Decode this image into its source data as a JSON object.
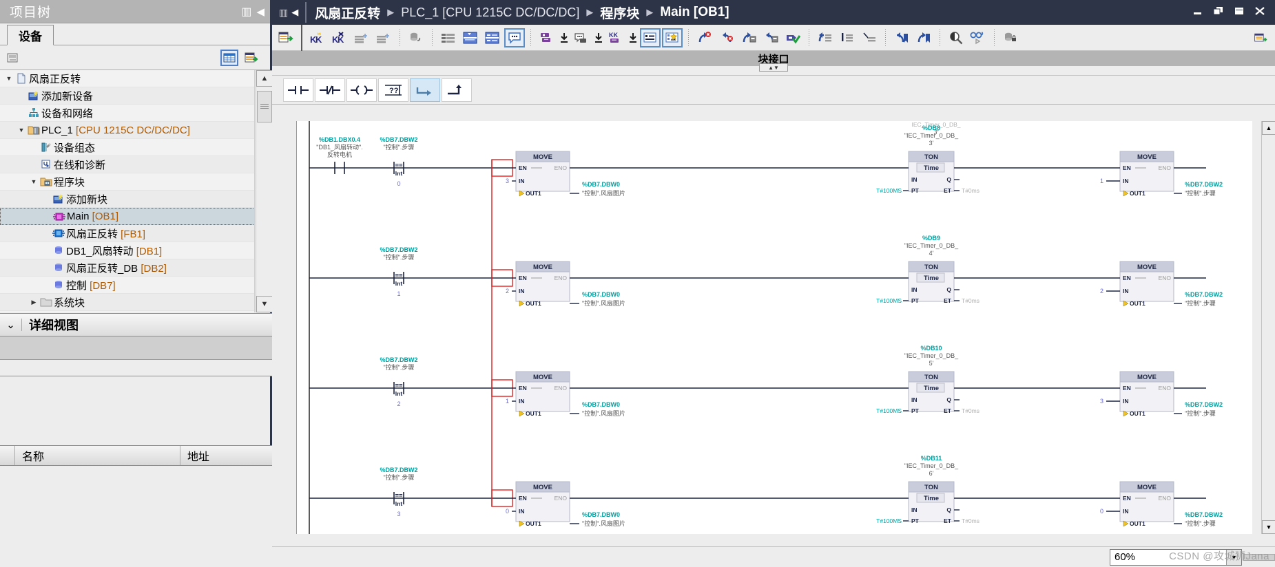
{
  "left_panel": {
    "title": "项目树",
    "title_icons": [
      "columns-icon",
      "collapse-left-icon"
    ],
    "tab": "设备",
    "toolbar_icons": [
      "snapshot-icon",
      "table-view-icon",
      "export-table-icon"
    ],
    "tree": [
      {
        "label": "风扇正反转",
        "icon": "project-icon",
        "indent": 0,
        "arrow": "▼",
        "selected": false
      },
      {
        "label": "添加新设备",
        "icon": "add-device-icon",
        "indent": 1,
        "arrow": "",
        "selected": false
      },
      {
        "label": "设备和网络",
        "icon": "network-icon",
        "indent": 1,
        "arrow": "",
        "selected": false
      },
      {
        "label": "PLC_1 [CPU 1215C DC/DC/DC]",
        "icon": "plc-folder-icon",
        "indent": 1,
        "arrow": "▼",
        "selected": false
      },
      {
        "label": "设备组态",
        "icon": "device-config-icon",
        "indent": 2,
        "arrow": "",
        "selected": false
      },
      {
        "label": "在线和诊断",
        "icon": "online-diagnostics-icon",
        "indent": 2,
        "arrow": "",
        "selected": false
      },
      {
        "label": "程序块",
        "icon": "program-blocks-folder-icon",
        "indent": 2,
        "arrow": "▼",
        "selected": false
      },
      {
        "label": "添加新块",
        "icon": "add-block-icon",
        "indent": 3,
        "arrow": "",
        "selected": false
      },
      {
        "label": "Main [OB1]",
        "icon": "ob-block-icon",
        "indent": 3,
        "arrow": "",
        "selected": true
      },
      {
        "label": "风扇正反转 [FB1]",
        "icon": "fb-block-icon",
        "indent": 3,
        "arrow": "",
        "selected": false
      },
      {
        "label": "DB1_风扇转动 [DB1]",
        "icon": "db-block-icon",
        "indent": 3,
        "arrow": "",
        "selected": false
      },
      {
        "label": "风扇正反转_DB [DB2]",
        "icon": "db-block-icon",
        "indent": 3,
        "arrow": "",
        "selected": false
      },
      {
        "label": "控制 [DB7]",
        "icon": "db-block-icon",
        "indent": 3,
        "arrow": "",
        "selected": false
      },
      {
        "label": "系统块",
        "icon": "system-blocks-folder-icon",
        "indent": 2,
        "arrow": "▶",
        "selected": false
      }
    ],
    "detail_view": {
      "title": "详细视图",
      "chevron": "⌄",
      "columns": [
        "名称",
        "地址"
      ],
      "rows": []
    }
  },
  "breadcrumb": {
    "back_icon": "back-arrow-icon",
    "grip_icon": "grip-icon",
    "items": [
      {
        "text": "风扇正反转",
        "bold": true
      },
      {
        "text": "PLC_1 [CPU 1215C DC/DC/DC]",
        "bold": false
      },
      {
        "text": "程序块",
        "bold": true
      },
      {
        "text": "Main [OB1]",
        "bold": true
      }
    ],
    "separator": "▶",
    "window_controls": [
      "minimize-icon",
      "restore-icon",
      "maximize-icon",
      "close-icon"
    ]
  },
  "main_toolbar": {
    "groups": [
      [
        "snapshot-table-icon"
      ],
      [
        "insert-network-icon",
        "delete-network-icon",
        "collapse-networks-icon",
        "expand-networks-icon"
      ],
      [
        "db-snapshot-icon"
      ],
      [
        "show-absolute-icon",
        "show-symbolic-icon",
        "show-both-icon",
        "comments-icon"
      ],
      [
        "download-to-device-icon",
        "download-start-icon",
        "upload-from-device-icon",
        "upload-start-icon",
        "monitor-sync-icon",
        "monitor-start-icon"
      ],
      [
        "layout-list-icon",
        "layout-favorites-icon"
      ],
      [
        "go-forward-error-icon",
        "go-back-error-icon",
        "forward-block-icon",
        "back-block-icon",
        "compile-ok-icon"
      ],
      [
        "indent-block-icon",
        "align-left-icon",
        "align-cut-icon"
      ],
      [
        "bookmark-prev-icon",
        "bookmark-next-icon"
      ],
      [
        "zoom-contrast-icon",
        "monitor-glasses-icon"
      ],
      [
        "db-lock-icon"
      ]
    ],
    "right_icon": "open-editor-icon",
    "selected": [
      "comments-icon",
      "layout-list-icon",
      "layout-favorites-icon"
    ]
  },
  "block_interface": {
    "label": "块接口",
    "handle_icon": "resize-handle-icon"
  },
  "lad_toolbar": {
    "buttons": [
      {
        "name": "no-contact",
        "glyph": "⊣ ⊢",
        "selected": false
      },
      {
        "name": "nc-contact",
        "glyph": "⊣/⊢",
        "selected": false
      },
      {
        "name": "coil",
        "glyph": "⊣()⊢",
        "selected": false
      },
      {
        "name": "empty-box",
        "glyph": "{??}",
        "selected": false
      },
      {
        "name": "open-branch",
        "glyph": "↳",
        "selected": true
      },
      {
        "name": "close-branch",
        "glyph": "⤴",
        "selected": false
      }
    ]
  },
  "statusbar": {
    "zoom_value": "60%",
    "zoom_dropdown_icon": "chevron-down-icon",
    "watermark": "CSDN @攻城狮Jana"
  },
  "ladder": {
    "top_partial": {
      "db_name": "IEC_Timer_0_DB_",
      "db_index": "3'"
    },
    "rungs": [
      {
        "contacts": [
          {
            "tag": "%DB1.DBX0.4",
            "comment_line1": "\"DB1_风扇转动\".",
            "comment_line2": "反转电机",
            "type": "no"
          },
          {
            "tag": "%DB7.DBW2",
            "comment_line1": "\"控制\".步骤",
            "comment_line2": "",
            "type": "compare",
            "op": "==",
            "datatype": "Int",
            "operand": "0"
          }
        ],
        "move_left": {
          "title": "MOVE",
          "en": "EN",
          "eno": "ENO",
          "in_value": "3",
          "in": "IN",
          "out": "OUT1",
          "out_tag": "%DB7.DBW0",
          "out_comment": "\"控制\".风扇图片"
        },
        "timer": {
          "db_tag": "%DB8",
          "db_name": "\"IEC_Timer_0_DB_",
          "db_index": "3'",
          "title": "TON",
          "subtitle": "Time",
          "in": "IN",
          "q": "Q",
          "pt": "PT",
          "et": "ET",
          "pt_value": "T#100MS",
          "et_value": "T#0ms"
        },
        "move_right": {
          "title": "MOVE",
          "en": "EN",
          "eno": "ENO",
          "in_value": "1",
          "in": "IN",
          "out": "OUT1",
          "out_tag": "%DB7.DBW2",
          "out_comment": "\"控制\".步骤"
        }
      },
      {
        "contacts": [
          {
            "tag": "%DB7.DBW2",
            "comment_line1": "\"控制\".步骤",
            "comment_line2": "",
            "type": "compare",
            "op": "==",
            "datatype": "Int",
            "operand": "1"
          }
        ],
        "move_left": {
          "title": "MOVE",
          "en": "EN",
          "eno": "ENO",
          "in_value": "2",
          "in": "IN",
          "out": "OUT1",
          "out_tag": "%DB7.DBW0",
          "out_comment": "\"控制\".风扇图片"
        },
        "timer": {
          "db_tag": "%DB9",
          "db_name": "\"IEC_Timer_0_DB_",
          "db_index": "4'",
          "title": "TON",
          "subtitle": "Time",
          "in": "IN",
          "q": "Q",
          "pt": "PT",
          "et": "ET",
          "pt_value": "T#100MS",
          "et_value": "T#0ms"
        },
        "move_right": {
          "title": "MOVE",
          "en": "EN",
          "eno": "ENO",
          "in_value": "2",
          "in": "IN",
          "out": "OUT1",
          "out_tag": "%DB7.DBW2",
          "out_comment": "\"控制\".步骤"
        }
      },
      {
        "contacts": [
          {
            "tag": "%DB7.DBW2",
            "comment_line1": "\"控制\".步骤",
            "comment_line2": "",
            "type": "compare",
            "op": "==",
            "datatype": "Int",
            "operand": "2"
          }
        ],
        "move_left": {
          "title": "MOVE",
          "en": "EN",
          "eno": "ENO",
          "in_value": "1",
          "in": "IN",
          "out": "OUT1",
          "out_tag": "%DB7.DBW0",
          "out_comment": "\"控制\".风扇图片"
        },
        "timer": {
          "db_tag": "%DB10",
          "db_name": "\"IEC_Timer_0_DB_",
          "db_index": "5'",
          "title": "TON",
          "subtitle": "Time",
          "in": "IN",
          "q": "Q",
          "pt": "PT",
          "et": "ET",
          "pt_value": "T#100MS",
          "et_value": "T#0ms"
        },
        "move_right": {
          "title": "MOVE",
          "en": "EN",
          "eno": "ENO",
          "in_value": "3",
          "in": "IN",
          "out": "OUT1",
          "out_tag": "%DB7.DBW2",
          "out_comment": "\"控制\".步骤"
        }
      },
      {
        "contacts": [
          {
            "tag": "%DB7.DBW2",
            "comment_line1": "\"控制\".步骤",
            "comment_line2": "",
            "type": "compare",
            "op": "==",
            "datatype": "Int",
            "operand": "3"
          }
        ],
        "move_left": {
          "title": "MOVE",
          "en": "EN",
          "eno": "ENO",
          "in_value": "0",
          "in": "IN",
          "out": "OUT1",
          "out_tag": "%DB7.DBW0",
          "out_comment": "\"控制\".风扇图片"
        },
        "timer": {
          "db_tag": "%DB11",
          "db_name": "\"IEC_Timer_0_DB_",
          "db_index": "6'",
          "title": "TON",
          "subtitle": "Time",
          "in": "IN",
          "q": "Q",
          "pt": "PT",
          "et": "ET",
          "pt_value": "T#100MS",
          "et_value": "T#0ms"
        },
        "move_right": {
          "title": "MOVE",
          "en": "EN",
          "eno": "ENO",
          "in_value": "0",
          "in": "IN",
          "out": "OUT1",
          "out_tag": "%DB7.DBW2",
          "out_comment": "\"控制\".步骤"
        }
      }
    ]
  },
  "colors": {
    "titlebar": "#2e3447",
    "panel": "#ededed",
    "accent_tag": "#00a0a0",
    "selection": "#ccd6dd",
    "block_header": "#c9ccdb"
  }
}
